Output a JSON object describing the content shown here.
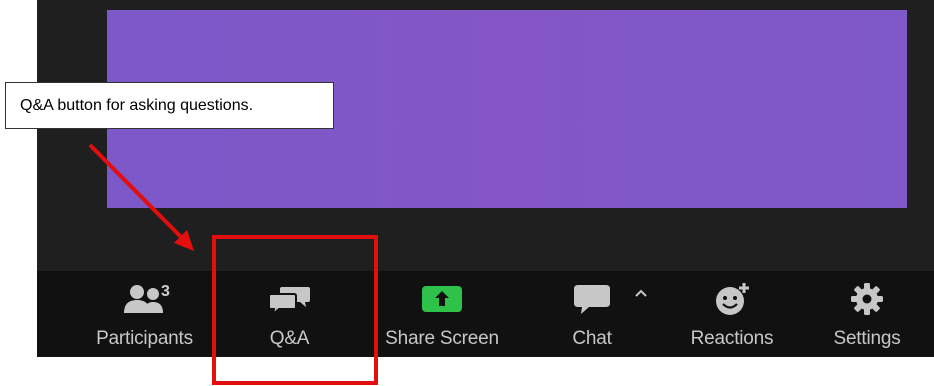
{
  "callout": {
    "text": "Q&A button for asking questions."
  },
  "toolbar": {
    "participants": {
      "label": "Participants",
      "count": "3",
      "icon": "participants-icon"
    },
    "qa": {
      "label": "Q&A",
      "icon": "qa-icon"
    },
    "share_screen": {
      "label": "Share Screen",
      "icon": "share-screen-icon"
    },
    "chat": {
      "label": "Chat",
      "icon": "chat-icon",
      "options_icon": "chevron-up-icon"
    },
    "reactions": {
      "label": "Reactions",
      "icon": "reactions-icon"
    },
    "settings": {
      "label": "Settings",
      "icon": "gear-icon"
    }
  },
  "colors": {
    "share_accent": "#2fc24a",
    "toolbar_text": "#c7c7c7",
    "video_purple": "#8056c6",
    "annotation_red": "#e30e0e"
  }
}
